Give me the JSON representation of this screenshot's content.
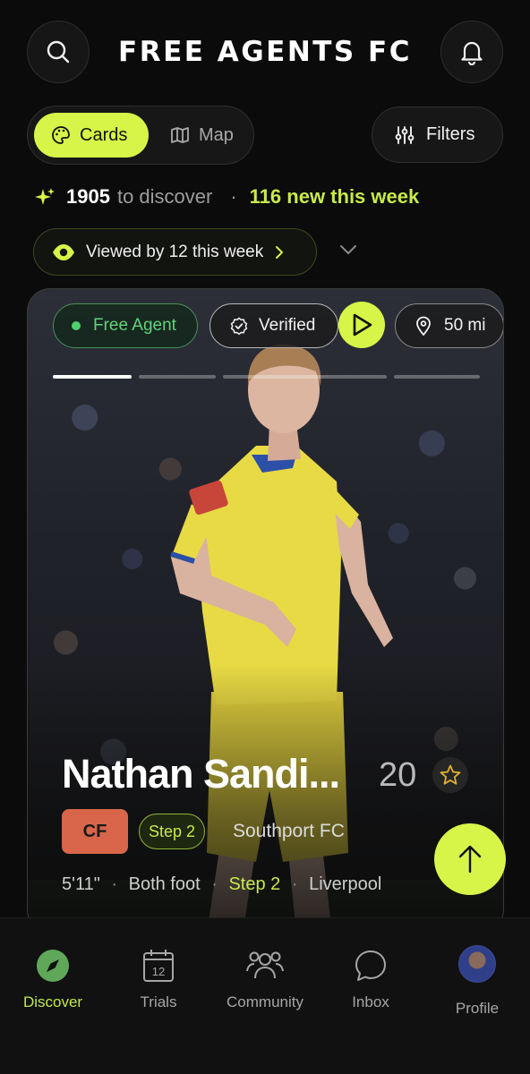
{
  "header": {
    "title": "FREE AGENTS FC",
    "search_icon": "search-icon",
    "bell_icon": "bell-icon"
  },
  "view_toggle": {
    "cards_label": "Cards",
    "map_label": "Map",
    "active": "Cards"
  },
  "filters": {
    "label": "Filters"
  },
  "stats": {
    "count": "1905",
    "count_suffix": "to discover",
    "separator": "·",
    "new_this_week": "116 new this week"
  },
  "viewed": {
    "label": "Viewed by 12 this week"
  },
  "card": {
    "status_chip": "Free Agent",
    "verified_chip": "Verified",
    "distance_chip": "50 mi",
    "progress_segments": 4,
    "active_segment": 1,
    "name": "Nathan Sandi...",
    "age": "20",
    "position": "CF",
    "step": "Step 2",
    "club": "Southport FC",
    "height": "5'11\"",
    "sep": "·",
    "foot": "Both foot",
    "step_meta": "Step 2",
    "location": "Liverpool"
  },
  "nav": {
    "items": [
      {
        "label": "Discover",
        "icon": "compass-icon"
      },
      {
        "label": "Trials",
        "icon": "calendar-icon",
        "icon_text": "12"
      },
      {
        "label": "Community",
        "icon": "users-icon"
      },
      {
        "label": "Inbox",
        "icon": "chat-bubble-icon"
      },
      {
        "label": "Profile",
        "icon": "avatar"
      }
    ],
    "active": "Discover"
  },
  "colors": {
    "accent": "#d6f548",
    "green_text": "#c8ea4a",
    "free_agent_green": "#5fd37a",
    "position_badge": "#d9664a",
    "background": "#0a0b0a"
  }
}
